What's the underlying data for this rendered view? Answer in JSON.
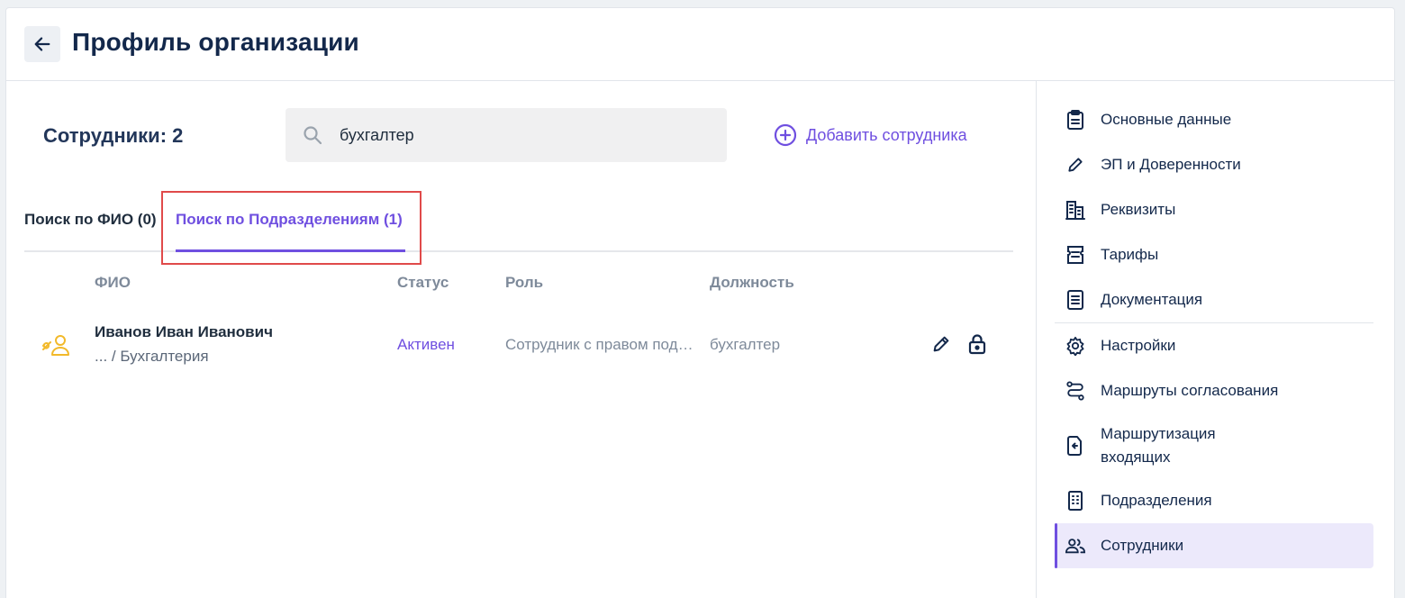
{
  "header": {
    "title": "Профиль организации",
    "back_icon": "arrow-left-icon"
  },
  "employees": {
    "count_label": "Сотрудники: 2",
    "search": {
      "value": "бухгалтер",
      "placeholder": ""
    },
    "add_label": "Добавить сотрудника",
    "tabs": [
      {
        "label": "Поиск по ФИО (0)",
        "active": false
      },
      {
        "label": "Поиск по Подразделениям (1)",
        "active": true
      }
    ],
    "columns": [
      "ФИО",
      "Статус",
      "Роль",
      "Должность"
    ],
    "rows": [
      {
        "name": "Иванов Иван Иванович",
        "path": "... / Бухгалтерия",
        "status": "Активен",
        "role": "Сотрудник с правом подписи",
        "position": "бухгалтер"
      }
    ]
  },
  "sidebar": {
    "items": [
      {
        "label": "Основные данные",
        "icon": "clipboard-icon"
      },
      {
        "label": "ЭП и Доверенности",
        "icon": "pencil-icon"
      },
      {
        "label": "Реквизиты",
        "icon": "building-icon"
      },
      {
        "label": "Тарифы",
        "icon": "ticket-icon"
      },
      {
        "label": "Документация",
        "icon": "document-icon"
      },
      {
        "label": "Настройки",
        "icon": "gear-icon"
      },
      {
        "label": "Маршруты согласования",
        "icon": "route-icon"
      },
      {
        "label": "Маршрутизация входящих",
        "icon": "inbox-import-icon"
      },
      {
        "label": "Подразделения",
        "icon": "office-building-icon"
      },
      {
        "label": "Сотрудники",
        "icon": "users-icon",
        "active": true
      }
    ]
  },
  "colors": {
    "accent": "#6f4fe0",
    "title": "#13284b",
    "highlight": "#e04a4a",
    "active_bg": "#ece9fb"
  }
}
